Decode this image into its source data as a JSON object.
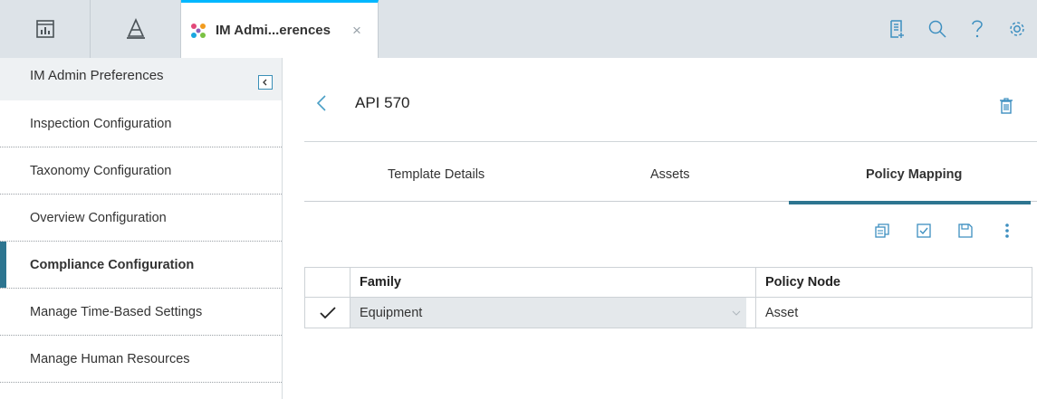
{
  "topbar": {
    "active_tab_title": "IM Admi...erences",
    "close_glyph": "×",
    "icons": [
      "dashboard-icon",
      "hierarchy-icon",
      "preferences-icon",
      "notes-icon",
      "search-icon",
      "help-icon",
      "settings-icon"
    ]
  },
  "sidebar": {
    "title": "IM Admin Preferences",
    "items": [
      {
        "label": "Inspection Configuration",
        "active": false
      },
      {
        "label": "Taxonomy Configuration",
        "active": false
      },
      {
        "label": "Overview Configuration",
        "active": false
      },
      {
        "label": "Compliance Configuration",
        "active": true
      },
      {
        "label": "Manage Time-Based Settings",
        "active": false
      },
      {
        "label": "Manage Human Resources",
        "active": false
      }
    ]
  },
  "main": {
    "title": "API 570",
    "tabs": [
      {
        "label": "Template Details",
        "active": false
      },
      {
        "label": "Assets",
        "active": false
      },
      {
        "label": "Policy Mapping",
        "active": true
      }
    ],
    "grid": {
      "headers": {
        "family": "Family",
        "policy_node": "Policy Node"
      },
      "rows": [
        {
          "checked": true,
          "family": "Equipment",
          "policy_node": "Asset"
        }
      ]
    }
  },
  "colors": {
    "accent": "#2d7590",
    "link": "#4a9fc6",
    "tab_top": "#00b7ff",
    "topbar_bg": "#dde3e8"
  }
}
